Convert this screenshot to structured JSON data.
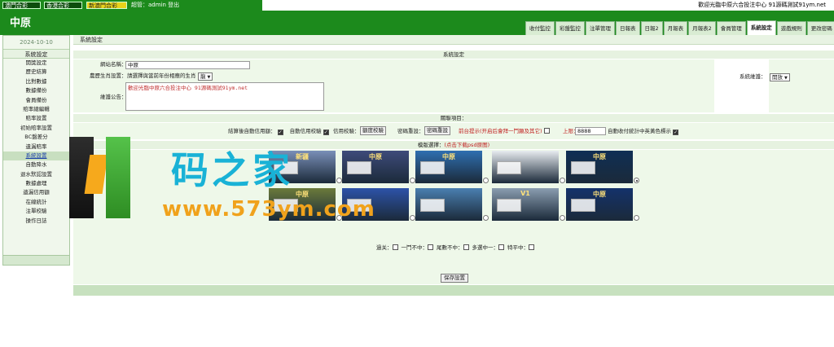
{
  "topbar": {
    "lotteries": [
      "澳門合彩",
      "香港合彩",
      "新澳門合彩"
    ],
    "admin_text": "超管：admin  登出",
    "welcome": "歡迎光臨中原六合投注中心 91源碼測試91ym.net"
  },
  "brand": "中原",
  "nav": {
    "tabs": [
      "收付監控",
      "彩盤監控",
      "注單管理",
      "日報表",
      "日報2",
      "月報表",
      "月報表2",
      "會員管理",
      "系統設定",
      "遊戲規則",
      "更改密碼"
    ],
    "active": "系統設定"
  },
  "sidebar": {
    "date": "2024-10-10",
    "section_title": "系統設定",
    "items": [
      "開獎設定",
      "歷史結算",
      "比對數據",
      "數據備份",
      "會員備份",
      "賠率總編輯",
      "賠率設置",
      "初始賠率設置",
      "BC盤差分",
      "遺漏賠率",
      "系統設置",
      "自動降水",
      "退水默認設置",
      "數據處理",
      "遺漏信用額",
      "在線統計",
      "注單校驗",
      "操作日誌"
    ],
    "active_item": "系統設置"
  },
  "main": {
    "breadcrumb": "系統設定",
    "section_settings": "系統設定",
    "site_name_label": "網站名稱：",
    "site_name_value": "中原",
    "zodiac_label": "農歷生肖設置：",
    "zodiac_hint": "請選擇與當前年份相應的生肖",
    "zodiac_value": "龍",
    "system_maintenance_label": "系統維護：",
    "system_maintenance_value": "開放",
    "notice_label": "維護公告：",
    "notice_value": "歡迎光臨中原六合投注中心 91源碼測試91ym.net",
    "section_related": "關聯項目：",
    "auto_credit_label": "結算後自動信用額：",
    "auto_credit_check_label": "自動信用校驗",
    "credit_check_label": "信用校驗：",
    "credit_check_button": "額度校驗",
    "password_reset_label": "密碼重設：",
    "password_reset_button": "密碼重設",
    "front_display_label": "前台提示(开启后會拜一鬥顯及其它)",
    "limit_label": "上限：",
    "limit_value": "8888",
    "auto_stat_label": "自動收付統計中英黃色標示",
    "section_template": "模版選擇：",
    "template_download": "(点击下载psd原图)",
    "templates": [
      {
        "title": "新疆",
        "bg": "#7a8fb8"
      },
      {
        "title": "中原",
        "bg": "#3e4b7a"
      },
      {
        "title": "中原",
        "bg": "#2f6fb0"
      },
      {
        "title": "",
        "bg": "#e8ecf0"
      },
      {
        "title": "中原",
        "bg": "#0f2f55"
      },
      {
        "title": "中原",
        "bg": "#6b7a3a"
      },
      {
        "title": "",
        "bg": "#2d53a8"
      },
      {
        "title": "",
        "bg": "#4a7fb0"
      },
      {
        "title": "V1",
        "bg": "#8a9db0"
      },
      {
        "title": "中原",
        "bg": "#14326b"
      }
    ],
    "selected_template_index": 4,
    "pass_rules": [
      "過关：",
      "一鬥不中：",
      "尾數不中：",
      "多選中一：",
      "特平中："
    ],
    "save_button": "保存設置"
  },
  "watermark": {
    "text": "码之家",
    "url": "www.573ym.com"
  },
  "colors": {
    "brand_green": "#1c8a1c",
    "panel_green": "#eef8e9"
  }
}
